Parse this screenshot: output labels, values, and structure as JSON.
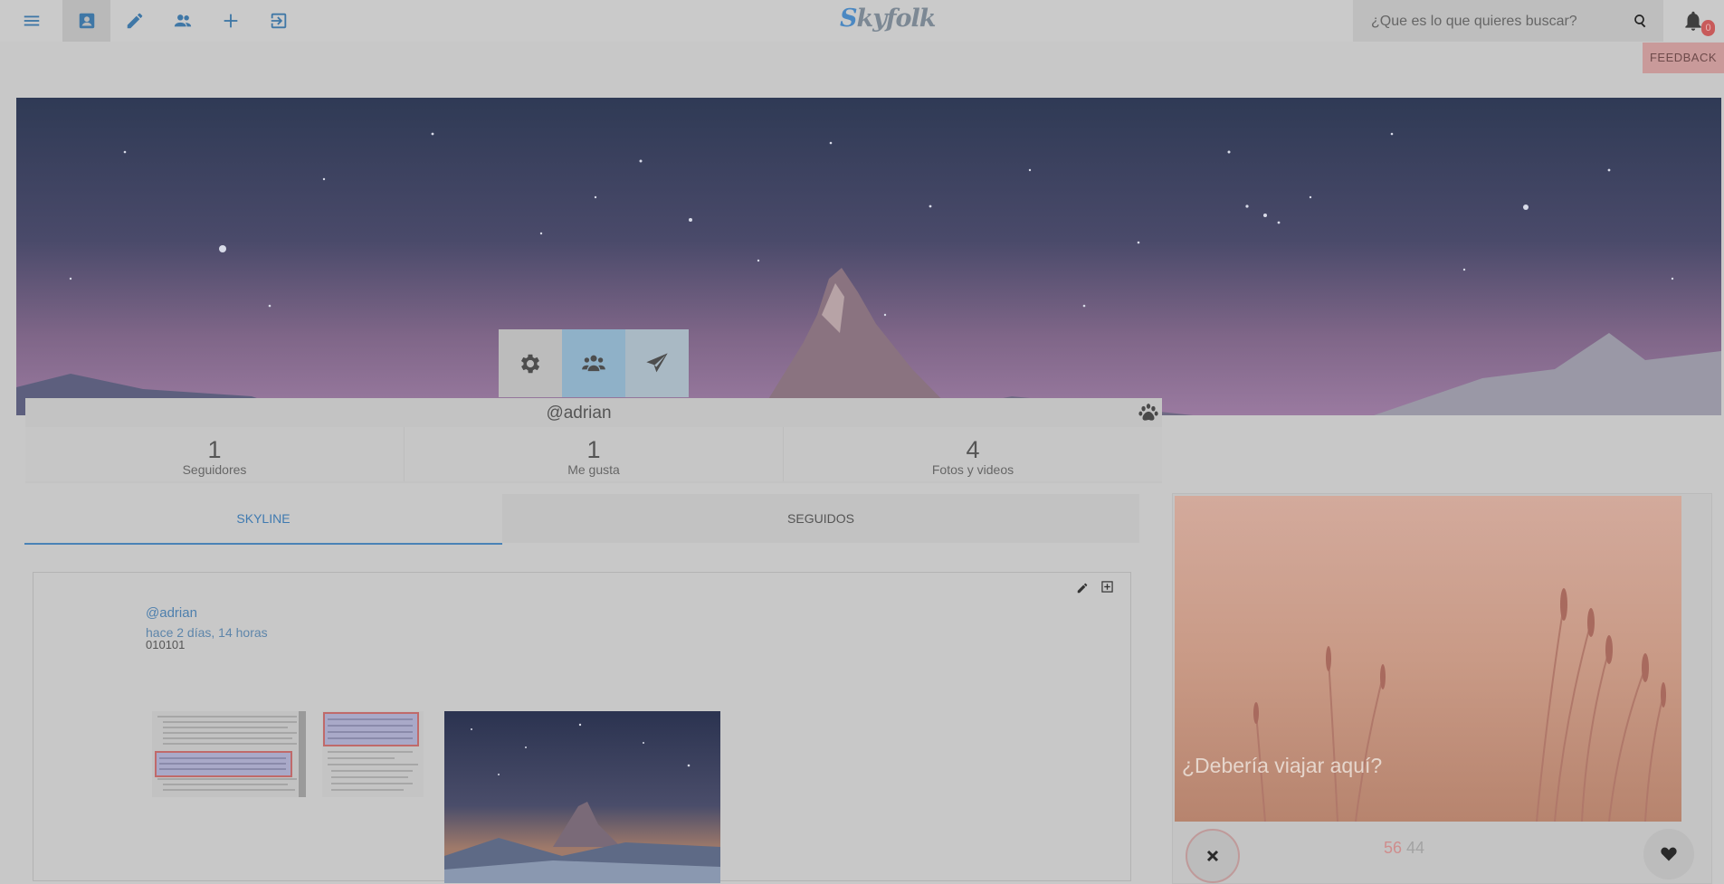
{
  "app": {
    "logo_first": "S",
    "logo_rest": "kyfolk"
  },
  "topbar": {
    "icons": [
      "menu-icon",
      "profile-icon",
      "pencil-icon",
      "people-icon",
      "plus-icon",
      "logout-icon"
    ],
    "search_placeholder": "¿Que es lo que quieres buscar?",
    "notification_count": "0"
  },
  "feedback_label": "FEEDBACK",
  "profile": {
    "username": "@adrian",
    "stats": [
      {
        "value": "1",
        "label": "Seguidores"
      },
      {
        "value": "1",
        "label": "Me gusta"
      },
      {
        "value": "4",
        "label": "Fotos y videos"
      }
    ]
  },
  "tabs": [
    "SKYLINE",
    "SEGUIDOS"
  ],
  "post": {
    "user": "@adrian",
    "time": "hace 2 días, 14 horas",
    "text": "010101"
  },
  "side_card": {
    "question": "¿Debería viajar aquí?",
    "count_a": "56",
    "count_b": "44"
  },
  "colors": {
    "accent": "#4a82b6",
    "overlay_bg": "#c8c8c8",
    "feedback": "#c99a9a"
  }
}
